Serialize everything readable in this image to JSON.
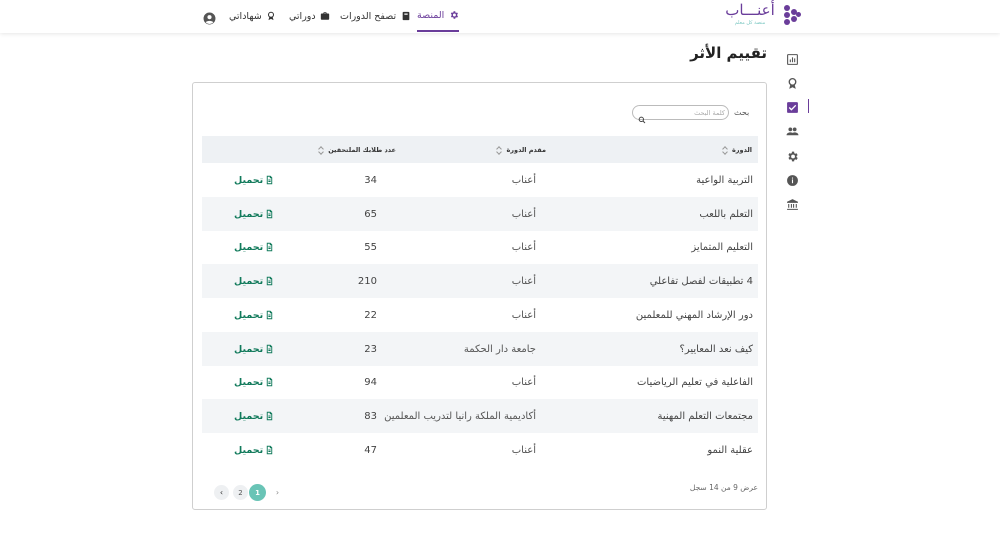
{
  "brand": {
    "name": "أعنـــاب",
    "tagline": "منصة كل معلم"
  },
  "nav": {
    "platform": "المنصة",
    "browse": "تصفح الدورات",
    "my_courses": "دوراتي",
    "certificates": "شهاداتي"
  },
  "page": {
    "title": "تقييم الأثر"
  },
  "search": {
    "label": "بحث",
    "placeholder": "كلمة البحث",
    "value": ""
  },
  "table": {
    "columns": [
      "الدورة",
      "مقدم الدورة",
      "عدد طلابك الملتحقين",
      ""
    ],
    "download_label": "تحميل",
    "rows": [
      {
        "course": "التربية الواعية",
        "provider": "أعناب",
        "count": "34"
      },
      {
        "course": "التعلم باللعب",
        "provider": "أعناب",
        "count": "65"
      },
      {
        "course": "التعليم المتمايز",
        "provider": "أعناب",
        "count": "55"
      },
      {
        "course": "4 تطبيقات لفصل تفاعلي",
        "provider": "أعناب",
        "count": "210"
      },
      {
        "course": "دور الإرشاد المهني للمعلمين",
        "provider": "أعناب",
        "count": "22"
      },
      {
        "course": "كيف نعد المعايير؟",
        "provider": "جامعة دار الحكمة",
        "count": "23"
      },
      {
        "course": "الفاعلية في تعليم الرياضيات",
        "provider": "أعناب",
        "count": "94"
      },
      {
        "course": "مجتمعات التعلم المهنية",
        "provider": "أكاديمية الملكة رانيا لتدريب المعلمين",
        "count": "83"
      },
      {
        "course": "عقلية النمو",
        "provider": "أعناب",
        "count": "47"
      }
    ]
  },
  "footer": {
    "records_text": "عرض 9 من 14 سجل",
    "pages": [
      "1",
      "2"
    ],
    "current_page": "1",
    "prev_glyph": "‹",
    "next_glyph": "›"
  },
  "colors": {
    "brand_purple": "#6a3d9a",
    "download_green": "#117a5b",
    "active_page": "#69c4b6",
    "header_bg": "#eef1f4"
  },
  "icons": {
    "side": [
      "chart-icon",
      "award-icon",
      "checkbox-icon",
      "people-icon",
      "gear-icon",
      "info-icon",
      "bank-icon"
    ]
  }
}
